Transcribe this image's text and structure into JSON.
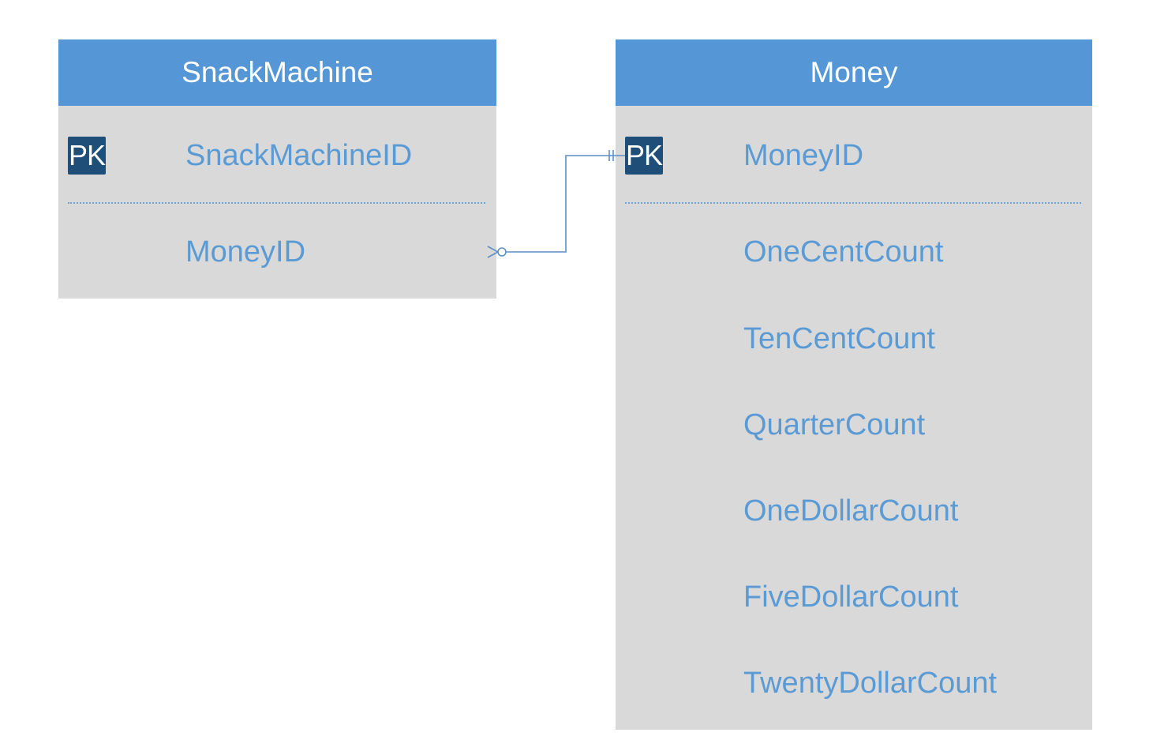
{
  "colors": {
    "header": "#5597d6",
    "body": "#d9d9d9",
    "field_text": "#5b9bd5",
    "pk_badge": "#1f4e79",
    "connector": "#5b8fc9"
  },
  "tables": [
    {
      "name": "SnackMachine",
      "pk_label": "PK",
      "pk_field": "SnackMachineID",
      "fields": [
        "MoneyID"
      ]
    },
    {
      "name": "Money",
      "pk_label": "PK",
      "pk_field": "MoneyID",
      "fields": [
        "OneCentCount",
        "TenCentCount",
        "QuarterCount",
        "OneDollarCount",
        "FiveDollarCount",
        "TwentyDollarCount"
      ]
    }
  ],
  "relationship": {
    "from": "SnackMachine.MoneyID",
    "to": "Money.MoneyID",
    "from_cardinality": "zero-or-many",
    "to_cardinality": "exactly-one"
  }
}
